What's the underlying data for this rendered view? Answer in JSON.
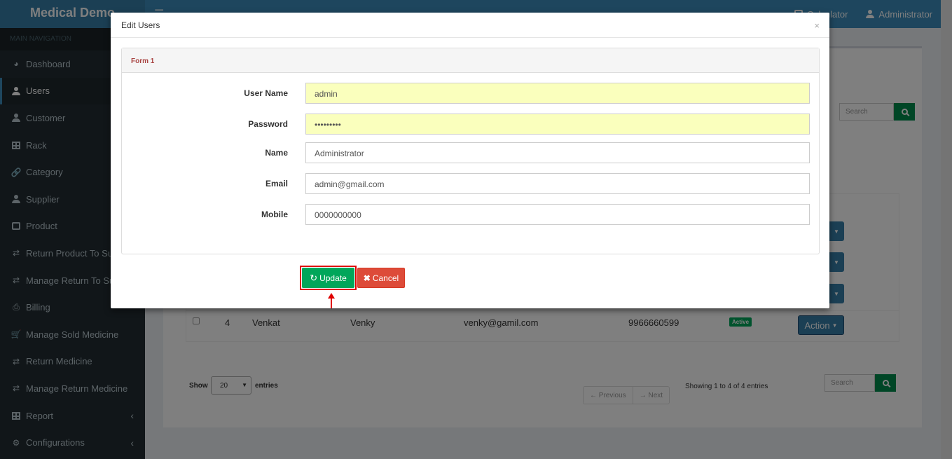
{
  "app": {
    "brand": "Medical Demo",
    "top_nav": {
      "calculator": "Calculator",
      "user": "Administrator"
    }
  },
  "sidebar": {
    "header": "MAIN NAVIGATION",
    "items": [
      {
        "label": "Dashboard",
        "icon": "dashboard-icon"
      },
      {
        "label": "Users",
        "icon": "user-icon",
        "active": true
      },
      {
        "label": "Customer",
        "icon": "user-icon"
      },
      {
        "label": "Rack",
        "icon": "table-icon"
      },
      {
        "label": "Category",
        "icon": "link-icon"
      },
      {
        "label": "Supplier",
        "icon": "user-icon"
      },
      {
        "label": "Product",
        "icon": "medkit-icon"
      },
      {
        "label": "Return Product To Supp",
        "icon": "exchange-icon"
      },
      {
        "label": "Manage Return To Supp",
        "icon": "exchange-icon"
      },
      {
        "label": "Billing",
        "icon": "print-icon"
      },
      {
        "label": "Manage Sold Medicine",
        "icon": "cart-icon"
      },
      {
        "label": "Return Medicine",
        "icon": "exchange-icon"
      },
      {
        "label": "Manage Return Medicine",
        "icon": "exchange-icon"
      },
      {
        "label": "Report",
        "icon": "table-icon",
        "expandable": true
      },
      {
        "label": "Configurations",
        "icon": "cogs-icon",
        "expandable": true
      }
    ]
  },
  "background": {
    "search_placeholder": "Search",
    "row": {
      "id": "4",
      "name": "Venkat",
      "username": "Venky",
      "email": "venky@gamil.com",
      "mobile": "9966660599",
      "status": "Active",
      "action": "Action"
    },
    "show_label": "Show",
    "entries_value": "20",
    "entries_label": "entries",
    "previous": "← Previous",
    "next": "→ Next",
    "showing": "Showing 1 to 4 of 4 entries"
  },
  "modal": {
    "title": "Edit Users",
    "close": "×",
    "panel_title": "Form 1",
    "fields": [
      {
        "label": "User Name",
        "value": "admin",
        "autofill": true
      },
      {
        "label": "Password",
        "value": "•••••••••",
        "autofill": true
      },
      {
        "label": "Name",
        "value": "Administrator",
        "autofill": false
      },
      {
        "label": "Email",
        "value": "admin@gmail.com",
        "autofill": false
      },
      {
        "label": "Mobile",
        "value": "0000000000",
        "autofill": false
      }
    ],
    "update_label": "Update",
    "cancel_label": "Cancel"
  },
  "colors": {
    "header_blue": "#3c8dbc",
    "sidebar_dark": "#222d32",
    "update_green": "#00a65a",
    "cancel_red": "#dd4b39",
    "highlight_red": "#e00000",
    "autofill_yellow": "#faffbd"
  }
}
